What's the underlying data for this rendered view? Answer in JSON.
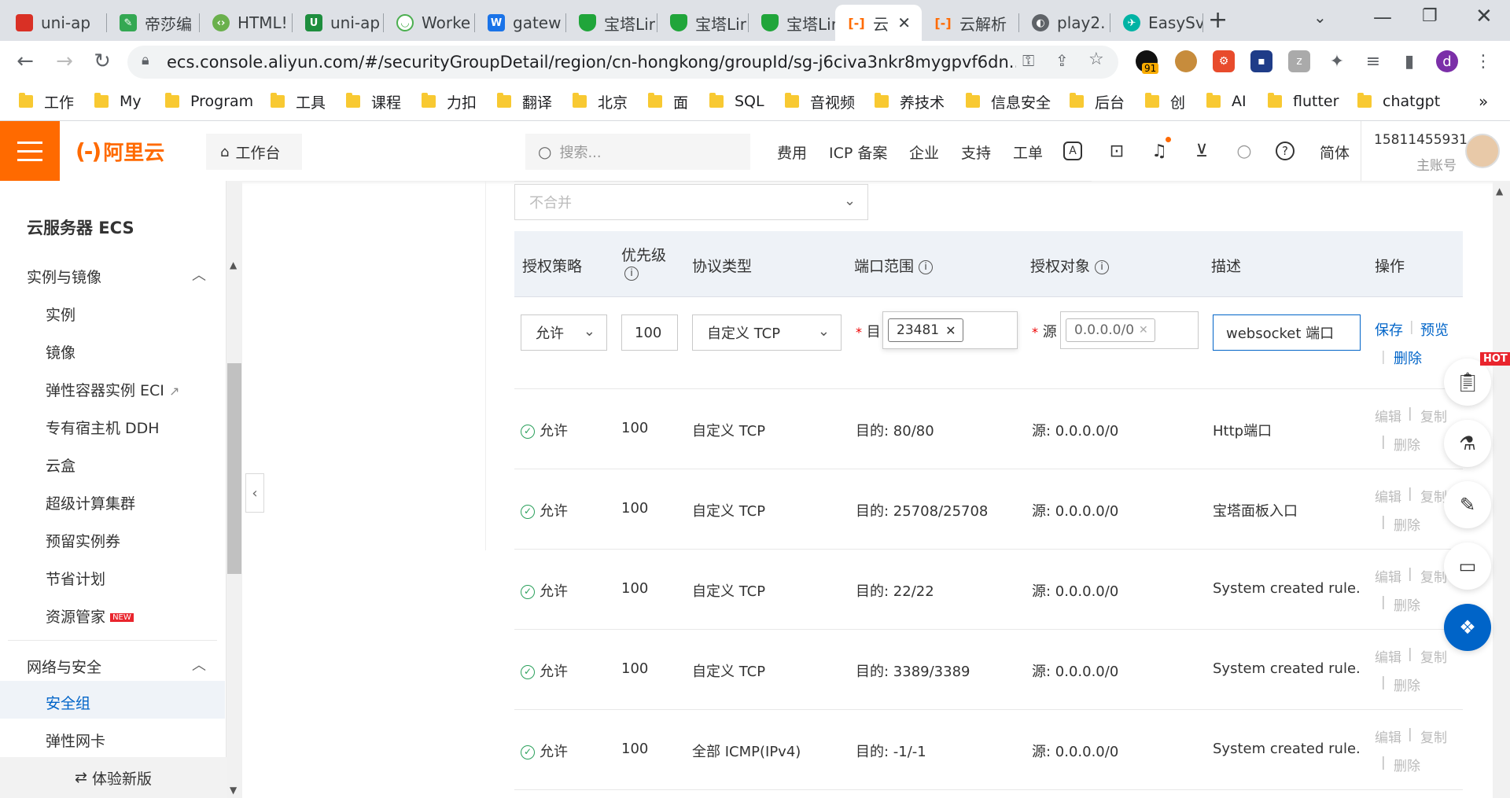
{
  "browser": {
    "tabs": [
      {
        "title": "uni-ap",
        "icon": "red-bookmark-icon",
        "color": "#d93025"
      },
      {
        "title": "帝莎编",
        "icon": "green-leaf-icon",
        "color": "#34a853"
      },
      {
        "title": "HTML!",
        "icon": "code-icon",
        "color": "#6ab04c"
      },
      {
        "title": "uni-ap",
        "icon": "u-icon",
        "color": "#1e8e3e"
      },
      {
        "title": "Worke",
        "icon": "worker-icon",
        "color": "#4caf50"
      },
      {
        "title": "gatew",
        "icon": "w-icon",
        "color": "#1a73e8"
      },
      {
        "title": "宝塔Lir",
        "icon": "baota-shield-icon",
        "color": "#20a53a"
      },
      {
        "title": "宝塔Lir",
        "icon": "baota-shield-icon",
        "color": "#20a53a"
      },
      {
        "title": "宝塔Lir",
        "icon": "baota-shield-icon",
        "color": "#20a53a"
      },
      {
        "title": "云",
        "icon": "aliyun-icon",
        "color": "#ff6a00"
      },
      {
        "title": "云解析",
        "icon": "aliyun-icon",
        "color": "#ff6a00"
      },
      {
        "title": "play2.",
        "icon": "globe-icon",
        "color": "#5f6368"
      },
      {
        "title": "EasySv",
        "icon": "easy-icon",
        "color": "#00b3a4"
      }
    ],
    "url": "ecs.console.aliyun.com/#/securityGroupDetail/region/cn-hongkong/groupId/sg-j6civa3nkr8mygpvf6dn...",
    "ext_badge": "91",
    "profile_letter": "d",
    "bookmarks": [
      "工作",
      "My",
      "Program",
      "工具",
      "课程",
      "力扣",
      "翻译",
      "北京",
      "面",
      "SQL",
      "音视频",
      "养技术",
      "信息安全",
      "后台",
      "创",
      "AI",
      "flutter",
      "chatgpt"
    ]
  },
  "topbar": {
    "logo_mark": "(-)",
    "logo_text": "阿里云",
    "workbench": "工作台",
    "search_placeholder": "搜索...",
    "links": [
      "费用",
      "ICP 备案",
      "企业",
      "支持",
      "工单"
    ],
    "lang": "简体",
    "account_id": "15811455931",
    "account_role": "主账号"
  },
  "sidebar": {
    "title": "云服务器 ECS",
    "group1": "实例与镜像",
    "group1_items": [
      "实例",
      "镜像",
      "弹性容器实例 ECI",
      "专有宿主机 DDH",
      "云盒",
      "超级计算集群",
      "预留实例券",
      "节省计划",
      "资源管家"
    ],
    "new_badge": "NEW",
    "group2": "网络与安全",
    "group2_items": [
      "安全组",
      "弹性网卡"
    ],
    "try_new": "体验新版"
  },
  "table": {
    "merge_select": "不合并",
    "headers": {
      "policy": "授权策略",
      "priority": "优先级",
      "protocol": "协议类型",
      "port": "端口范围",
      "target": "授权对象",
      "desc": "描述",
      "ops": "操作"
    },
    "edit_row": {
      "policy": "允许",
      "priority": "100",
      "protocol": "自定义 TCP",
      "port_prefix": "目",
      "port_chip": "23481",
      "src_prefix": "源",
      "src_chip": "0.0.0.0/0",
      "desc": "websocket 端口",
      "save": "保存",
      "preview": "预览",
      "delete": "删除"
    },
    "rows": [
      {
        "policy": "允许",
        "priority": "100",
        "protocol": "自定义 TCP",
        "port": "目的: 80/80",
        "src": "源: 0.0.0.0/0",
        "desc": "Http端口"
      },
      {
        "policy": "允许",
        "priority": "100",
        "protocol": "自定义 TCP",
        "port": "目的: 25708/25708",
        "src": "源: 0.0.0.0/0",
        "desc": "宝塔面板入口"
      },
      {
        "policy": "允许",
        "priority": "100",
        "protocol": "自定义 TCP",
        "port": "目的: 22/22",
        "src": "源: 0.0.0.0/0",
        "desc": "System created rule."
      },
      {
        "policy": "允许",
        "priority": "100",
        "protocol": "自定义 TCP",
        "port": "目的: 3389/3389",
        "src": "源: 0.0.0.0/0",
        "desc": "System created rule."
      },
      {
        "policy": "允许",
        "priority": "100",
        "protocol": "全部 ICMP(IPv4)",
        "port": "目的: -1/-1",
        "src": "源: 0.0.0.0/0",
        "desc": "System created rule."
      }
    ],
    "row_ops": {
      "edit": "编辑",
      "copy": "复制",
      "delete": "删除"
    }
  },
  "float_tools": {
    "hot": "HOT"
  }
}
